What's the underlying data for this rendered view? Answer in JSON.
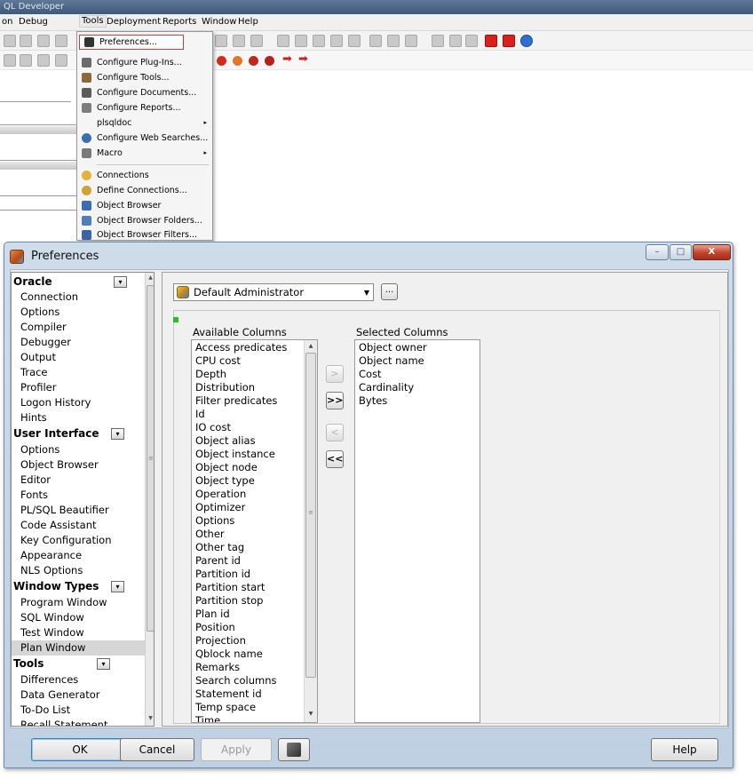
{
  "ide": {
    "title": "QL Developer",
    "menus": [
      "on",
      "Debug",
      "Tools",
      "Deployment",
      "Reports",
      "Window",
      "Help"
    ],
    "tools_menu": {
      "items": [
        {
          "label": "Preferences...",
          "icon": "wrench-icon",
          "has_submenu": false
        },
        {
          "label": "Configure Plug-Ins...",
          "icon": "plugin-icon",
          "has_submenu": false
        },
        {
          "label": "Configure Tools...",
          "icon": "tools-icon",
          "has_submenu": false
        },
        {
          "label": "Configure Documents...",
          "icon": "documents-icon",
          "has_submenu": false
        },
        {
          "label": "Configure Reports...",
          "icon": "reports-icon",
          "has_submenu": false
        },
        {
          "label": "plsqldoc",
          "icon": "",
          "has_submenu": true
        },
        {
          "label": "Configure Web Searches...",
          "icon": "web-search-icon",
          "has_submenu": false
        },
        {
          "label": "Macro",
          "icon": "macro-icon",
          "has_submenu": true
        },
        {
          "label": "Connections",
          "icon": "connections-icon",
          "has_submenu": false
        },
        {
          "label": "Define Connections...",
          "icon": "define-connections-icon",
          "has_submenu": false
        },
        {
          "label": "Object Browser",
          "icon": "object-browser-icon",
          "has_submenu": false
        },
        {
          "label": "Object Browser Folders...",
          "icon": "object-browser-folders-icon",
          "has_submenu": false
        },
        {
          "label": "Object Browser Filters...",
          "icon": "object-browser-filters-icon",
          "has_submenu": false
        }
      ],
      "submenu_arrow": "▸"
    }
  },
  "dialog": {
    "title": "Preferences",
    "window_buttons": {
      "minimize": "–",
      "maximize": "□",
      "close": "X"
    },
    "tree": {
      "categories": [
        {
          "label": "Oracle",
          "toggle": "▾",
          "items": [
            "Connection",
            "Options",
            "Compiler",
            "Debugger",
            "Output",
            "Trace",
            "Profiler",
            "Logon History",
            "Hints"
          ]
        },
        {
          "label": "User Interface",
          "toggle": "▾",
          "items": [
            "Options",
            "Object Browser",
            "Editor",
            "Fonts",
            "PL/SQL Beautifier",
            "Code Assistant",
            "Key Configuration",
            "Appearance",
            "NLS Options"
          ]
        },
        {
          "label": "Window Types",
          "toggle": "▾",
          "items": [
            "Program Window",
            "SQL Window",
            "Test Window",
            "Plan Window"
          ]
        },
        {
          "label": "Tools",
          "toggle": "▾",
          "items": [
            "Differences",
            "Data Generator",
            "To-Do List",
            "Recall Statement"
          ]
        }
      ],
      "selected": "Plan Window"
    },
    "profile": {
      "value": "Default Administrator",
      "browse_label": "..."
    },
    "available_columns": {
      "label": "Available Columns",
      "items": [
        "Access predicates",
        "CPU cost",
        "Depth",
        "Distribution",
        "Filter predicates",
        "Id",
        "IO cost",
        "Object alias",
        "Object instance",
        "Object node",
        "Object type",
        "Operation",
        "Optimizer",
        "Options",
        "Other",
        "Other tag",
        "Parent id",
        "Partition id",
        "Partition start",
        "Partition stop",
        "Plan id",
        "Position",
        "Projection",
        "Qblock name",
        "Remarks",
        "Search columns",
        "Statement id",
        "Temp space",
        "Time"
      ]
    },
    "selected_columns": {
      "label": "Selected Columns",
      "items": [
        "Object owner",
        "Object name",
        "Cost",
        "Cardinality",
        "Bytes"
      ]
    },
    "move_buttons": {
      "add": ">",
      "add_all": ">>",
      "remove": "<",
      "remove_all": "<<"
    },
    "buttons": {
      "ok": "OK",
      "cancel": "Cancel",
      "apply": "Apply",
      "help": "Help"
    },
    "colors": {
      "accent_green": "#27c024",
      "title_bar": "#c7d6e6",
      "close_red": "#c2432b"
    }
  }
}
